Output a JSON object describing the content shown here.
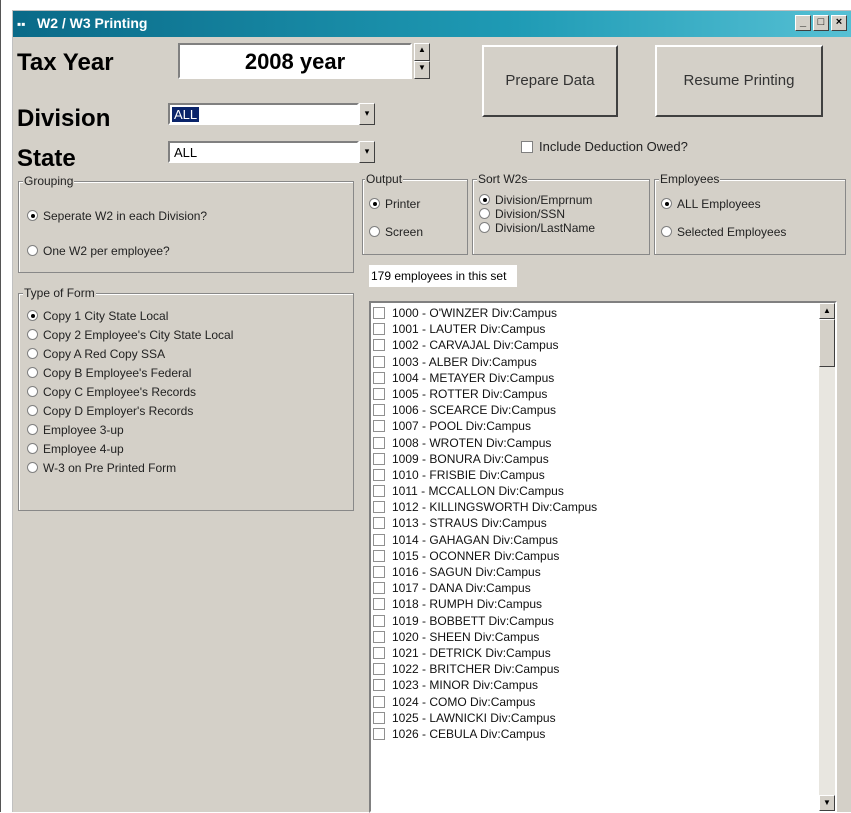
{
  "window": {
    "title": "W2 / W3 Printing",
    "title_icon": "app-icon"
  },
  "tax_year": {
    "label": "Tax Year",
    "value": "2008 year"
  },
  "division": {
    "label": "Division",
    "value": "ALL"
  },
  "state": {
    "label": "State",
    "value": "ALL"
  },
  "buttons": {
    "prepare": "Prepare Data",
    "resume": "Resume Printing"
  },
  "include_deduction": {
    "label": "Include Deduction Owed?",
    "checked": false
  },
  "grouping": {
    "title": "Grouping",
    "options": [
      "Seperate W2 in each Division?",
      "One W2 per employee?"
    ],
    "selected": 0
  },
  "output": {
    "title": "Output",
    "options": [
      "Printer",
      "Screen"
    ],
    "selected": 0
  },
  "sort": {
    "title": "Sort W2s",
    "options": [
      "Division/Emprnum",
      "Division/SSN",
      "Division/LastName"
    ],
    "selected": 0
  },
  "employees_group": {
    "title": "Employees",
    "options": [
      "ALL Employees",
      "Selected Employees"
    ],
    "selected": 0
  },
  "type_of_form": {
    "title": "Type of Form",
    "options": [
      "Copy 1 City State Local",
      "Copy 2 Employee's City State Local",
      "Copy A Red Copy SSA",
      "Copy B Employee's Federal",
      "Copy C Employee's Records",
      "Copy D Employer's Records",
      "Employee 3-up",
      "Employee 4-up",
      "W-3 on Pre Printed Form"
    ],
    "selected": 0
  },
  "count_text": "179 employees in this set",
  "employees": [
    "1000 - O'WINZER  Div:Campus",
    "1001 - LAUTER  Div:Campus",
    "1002 - CARVAJAL  Div:Campus",
    "1003 - ALBER  Div:Campus",
    "1004 - METAYER  Div:Campus",
    "1005 - ROTTER  Div:Campus",
    "1006 - SCEARCE  Div:Campus",
    "1007 - POOL  Div:Campus",
    "1008 - WROTEN  Div:Campus",
    "1009 - BONURA  Div:Campus",
    "1010 - FRISBIE  Div:Campus",
    "1011 - MCCALLON  Div:Campus",
    "1012 - KILLINGSWORTH  Div:Campus",
    "1013 - STRAUS  Div:Campus",
    "1014 - GAHAGAN  Div:Campus",
    "1015 - OCONNER  Div:Campus",
    "1016 - SAGUN  Div:Campus",
    "1017 - DANA  Div:Campus",
    "1018 - RUMPH  Div:Campus",
    "1019 - BOBBETT  Div:Campus",
    "1020 - SHEEN  Div:Campus",
    "1021 - DETRICK  Div:Campus",
    "1022 - BRITCHER  Div:Campus",
    "1023 - MINOR  Div:Campus",
    "1024 - COMO  Div:Campus",
    "1025 - LAWNICKI  Div:Campus",
    "1026 - CEBULA  Div:Campus"
  ],
  "colors": {
    "titlebar": "#0a6a88",
    "face": "#d4d0c8",
    "selection": "#0a246a"
  }
}
